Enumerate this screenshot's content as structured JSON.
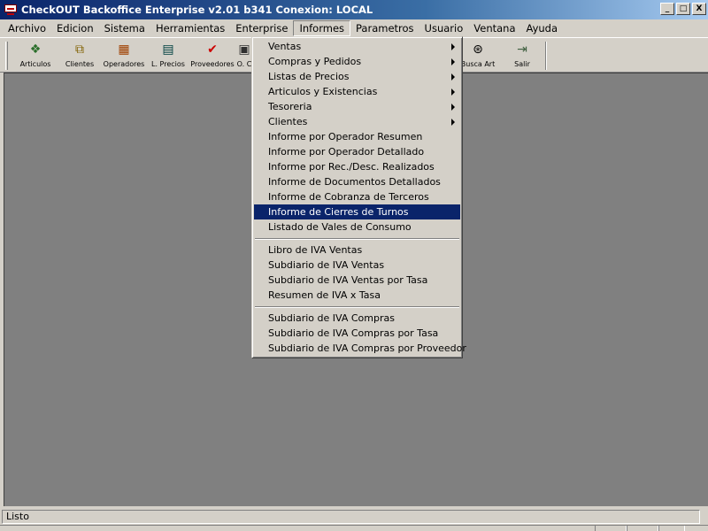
{
  "window": {
    "title": "CheckOUT Backoffice Enterprise v2.01 b341 Conexion: LOCAL",
    "minimize": "_",
    "maximize": "□",
    "close": "X"
  },
  "menubar": [
    "Archivo",
    "Edicion",
    "Sistema",
    "Herramientas",
    "Enterprise",
    "Informes",
    "Parametros",
    "Usuario",
    "Ventana",
    "Ayuda"
  ],
  "toolbar": [
    {
      "label": "Articulos",
      "icon": "articulos-icon",
      "glyph": "❖",
      "color": "#2a6e2a"
    },
    {
      "label": "Clientes",
      "icon": "clientes-icon",
      "glyph": "⧉",
      "color": "#806000"
    },
    {
      "label": "Operadores",
      "icon": "operadores-icon",
      "glyph": "▦",
      "color": "#a04000"
    },
    {
      "label": "L. Precios",
      "icon": "lista-precios-icon",
      "glyph": "▤",
      "color": "#004040"
    },
    {
      "label": "Proveedores",
      "icon": "proveedores-icon",
      "glyph": "✔",
      "color": "#cc0000"
    },
    {
      "label": "O. C",
      "icon": "ordenes-compra-icon",
      "glyph": "▣",
      "color": "#303030"
    },
    {
      "label": "Busca Art",
      "icon": "binoculars-icon",
      "glyph": "⊛",
      "color": "#000000"
    },
    {
      "label": "Salir",
      "icon": "exit-door-icon",
      "glyph": "⇥",
      "color": "#406040"
    }
  ],
  "dropdown": {
    "items": [
      {
        "label": "Ventas",
        "submenu": true
      },
      {
        "label": "Compras y Pedidos",
        "submenu": true
      },
      {
        "label": "Listas de Precios",
        "submenu": true
      },
      {
        "label": "Articulos y Existencias",
        "submenu": true
      },
      {
        "label": "Tesoreria",
        "submenu": true
      },
      {
        "label": "Clientes",
        "submenu": true
      },
      {
        "label": "Informe por Operador Resumen"
      },
      {
        "label": "Informe por Operador Detallado"
      },
      {
        "label": "Informe por Rec./Desc. Realizados"
      },
      {
        "label": "Informe de Documentos Detallados"
      },
      {
        "label": "Informe de Cobranza de Terceros"
      },
      {
        "label": "Informe de Cierres de Turnos",
        "highlighted": true
      },
      {
        "label": "Listado de Vales de Consumo"
      },
      {
        "separator": true
      },
      {
        "label": "Libro de IVA Ventas"
      },
      {
        "label": "Subdiario de IVA Ventas"
      },
      {
        "label": "Subdiario de IVA Ventas por Tasa"
      },
      {
        "label": "Resumen de IVA x Tasa"
      },
      {
        "separator": true
      },
      {
        "label": "Subdiario de IVA Compras"
      },
      {
        "label": "Subdiario de IVA Compras por Tasa"
      },
      {
        "label": "Subdiario de IVA Compras por Proveedor"
      }
    ]
  },
  "statusbar": {
    "text": "Listo"
  }
}
